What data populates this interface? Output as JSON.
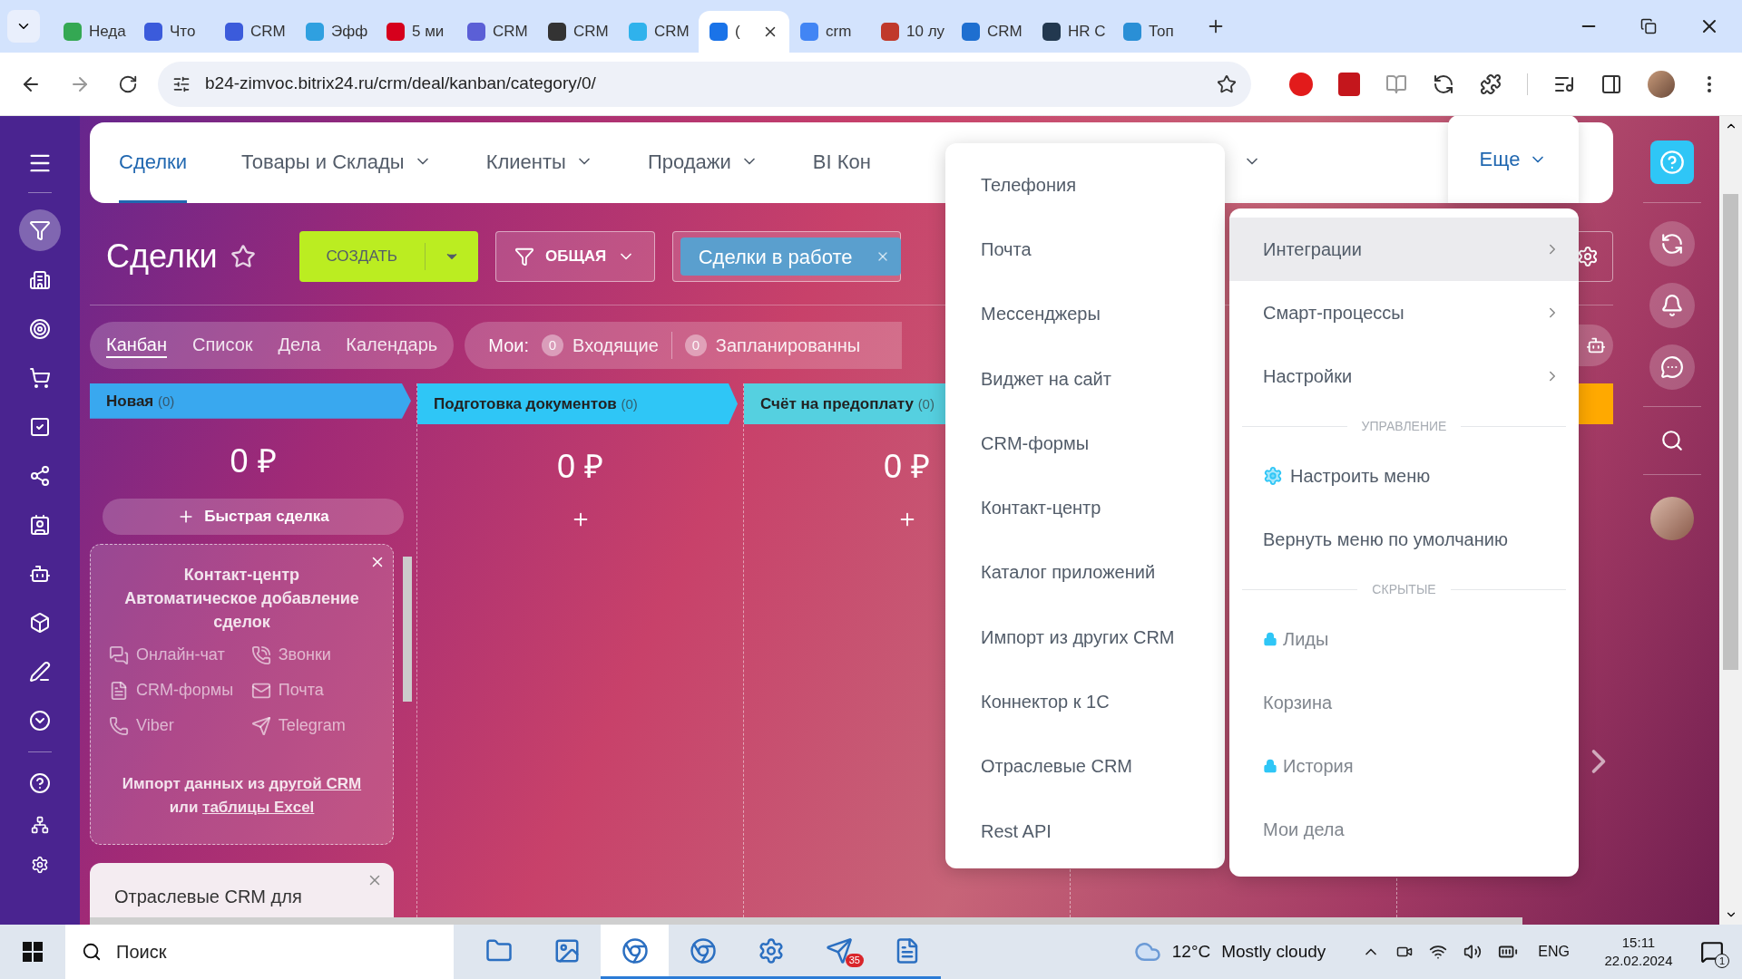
{
  "browser": {
    "tabs": [
      {
        "title": "Неда",
        "selected": false,
        "color": "#34a853"
      },
      {
        "title": "Что",
        "selected": false,
        "color": "#3b5bdb"
      },
      {
        "title": "CRM",
        "selected": false,
        "color": "#3b5bdb"
      },
      {
        "title": "Эфф",
        "selected": false,
        "color": "#2fa0e0"
      },
      {
        "title": "5 ми",
        "selected": false,
        "color": "#d6001c"
      },
      {
        "title": "CRM",
        "selected": false,
        "color": "#5b5fd6"
      },
      {
        "title": "CRM",
        "selected": false,
        "color": "#333333"
      },
      {
        "title": "CRM",
        "selected": false,
        "color": "#2fb2ec"
      },
      {
        "title": "(",
        "selected": true,
        "color": "#1a73e8"
      },
      {
        "title": "crm",
        "selected": false,
        "color": "#4285f4"
      },
      {
        "title": "10 лу",
        "selected": false,
        "color": "#c0392b"
      },
      {
        "title": "CRM",
        "selected": false,
        "color": "#1e6fd0"
      },
      {
        "title": "HR C",
        "selected": false,
        "color": "#22384f"
      },
      {
        "title": "Топ",
        "selected": false,
        "color": "#2a8fd6"
      }
    ],
    "url": "b24-zimvoc.bitrix24.ru/crm/deal/kanban/category/0/"
  },
  "nav": {
    "items": [
      {
        "label": "Сделки",
        "selected": true,
        "dropdown": false
      },
      {
        "label": "Товары и Склады",
        "selected": false,
        "dropdown": true
      },
      {
        "label": "Клиенты",
        "selected": false,
        "dropdown": true
      },
      {
        "label": "Продажи",
        "selected": false,
        "dropdown": true
      },
      {
        "label": "BI Кон",
        "selected": false,
        "dropdown": false
      },
      {
        "selected": false,
        "dropdown": true
      }
    ],
    "more": {
      "label": "Еще",
      "selected": true
    }
  },
  "toolbar": {
    "title": "Сделки",
    "favorite": false,
    "create": "СОЗДАТЬ",
    "category": "ОБЩАЯ",
    "filter_chips": [
      "Сделки в работе"
    ]
  },
  "views": [
    {
      "label": "Канбан",
      "selected": true
    },
    {
      "label": "Список",
      "selected": false
    },
    {
      "label": "Дела",
      "selected": false
    },
    {
      "label": "Календарь",
      "selected": false
    }
  ],
  "counters": {
    "label": "Мои:",
    "items": [
      {
        "count": "0",
        "label": "Входящие"
      },
      {
        "count": "0",
        "label": "Запланированны"
      }
    ]
  },
  "kanban": {
    "columns": [
      {
        "title": "Новая",
        "count": "(0)",
        "color": "#39a8ef",
        "sum": "0 ₽",
        "add": "Быстрая сделка"
      },
      {
        "title": "Подготовка документов",
        "count": "(0)",
        "color": "#2fc6f6",
        "sum": "0 ₽"
      },
      {
        "title": "Счёт на предоплату",
        "count": "(0)",
        "color": "#55d0e0",
        "sum": "0 ₽"
      },
      {
        "color": "#ffa900"
      }
    ],
    "contact_card": {
      "title": "Контакт-центр",
      "subtitle": "Автоматическое добавление сделок",
      "channels": [
        "Онлайн-чат",
        "Звонки",
        "CRM-формы",
        "Почта",
        "Viber",
        "Telegram"
      ],
      "import": {
        "before": "Импорт данных из",
        "link1": "другой CRM",
        "middle": "или",
        "link2": "таблицы Excel"
      }
    },
    "industry_card": {
      "title": "Отраслевые CRM для"
    }
  },
  "more_menu": {
    "items": [
      "Телефония",
      "Почта",
      "Мессенджеры",
      "Виджет на сайт",
      "CRM-формы",
      "Контакт-центр",
      "Каталог приложений",
      "Импорт из других CRM",
      "Коннектор к 1С",
      "Отраслевые CRM",
      "Rest API"
    ]
  },
  "submenu": {
    "items": [
      {
        "kind": "item",
        "label": "Интеграции",
        "selected": true,
        "arrow": true
      },
      {
        "kind": "item",
        "label": "Смарт-процессы",
        "selected": false,
        "arrow": true
      },
      {
        "kind": "item",
        "label": "Настройки",
        "selected": false,
        "arrow": true
      },
      {
        "kind": "section",
        "label": "УПРАВЛЕНИЕ"
      },
      {
        "kind": "setting",
        "label": "Настроить меню"
      },
      {
        "kind": "item",
        "label": "Вернуть меню по умолчанию",
        "selected": false
      },
      {
        "kind": "section",
        "label": "СКРЫТЫЕ"
      },
      {
        "kind": "item",
        "label": "Лиды",
        "selected": false,
        "hidden": true,
        "locked": true
      },
      {
        "kind": "item",
        "label": "Корзина",
        "selected": false,
        "hidden": true
      },
      {
        "kind": "item",
        "label": "История",
        "selected": false,
        "hidden": true,
        "locked": true
      },
      {
        "kind": "item",
        "label": "Мои дела",
        "selected": false,
        "hidden": true
      }
    ]
  },
  "taskbar": {
    "search": "Поиск",
    "apps": [
      {
        "running": false,
        "selected": false
      },
      {
        "running": false,
        "selected": false
      },
      {
        "running": true,
        "selected": true
      },
      {
        "running": true,
        "selected": false
      },
      {
        "running": true,
        "selected": false
      },
      {
        "running": true,
        "selected": false,
        "badge": "35"
      },
      {
        "running": true,
        "selected": false
      }
    ],
    "weather": {
      "temp": "12°C",
      "text": "Mostly cloudy"
    },
    "lang": "ENG",
    "time": "15:11",
    "date": "22.02.2024",
    "notifications": "1"
  }
}
